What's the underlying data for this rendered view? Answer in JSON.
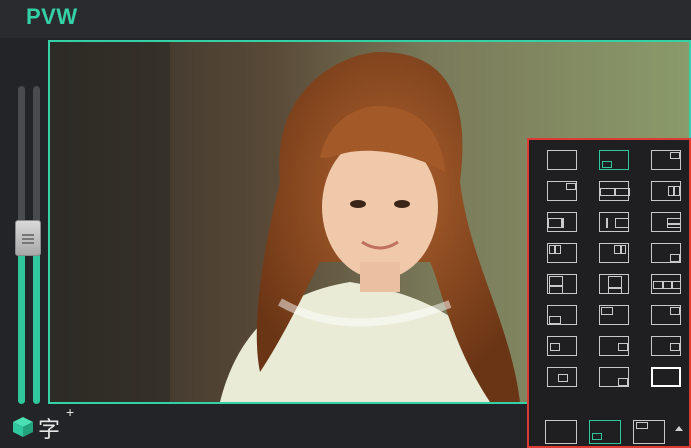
{
  "header": {
    "title": "PVW"
  },
  "toolbar": {
    "text_tool_glyph": "字",
    "text_tool_plus": "+"
  },
  "audio": {
    "level_left_pct": 48,
    "level_right_pct": 50,
    "fader_level_pct": 58
  },
  "colors": {
    "accent": "#34d0a6",
    "highlight_border": "#e03a35",
    "selected_layout": "#2fc79b"
  },
  "layout_panel": {
    "layouts": [
      "layout-full",
      "layout-pip-bottom-left",
      "layout-pip-top-left",
      "layout-pip-top-right",
      "layout-split-2",
      "layout-split-2-small",
      "layout-split-left-large",
      "layout-split-right-large",
      "layout-quad-right",
      "layout-pip-topleft-offset",
      "layout-pip-topright-offset",
      "layout-pip-bottom-right",
      "layout-left-column",
      "layout-center-column",
      "layout-triple",
      "layout-pip-bottom-left-2",
      "layout-pip-top-left-2",
      "layout-pip-top-right-2",
      "layout-inset-left",
      "layout-inset-right",
      "layout-inset-right-2",
      "layout-inset-center-right",
      "layout-pip-bottom-right-2",
      "layout-blank"
    ],
    "selected_index": 1,
    "active_index": 23,
    "quick_layouts": [
      "layout-full",
      "layout-pip-bottom-left",
      "layout-pip-top-left"
    ],
    "quick_selected_index": 1
  }
}
